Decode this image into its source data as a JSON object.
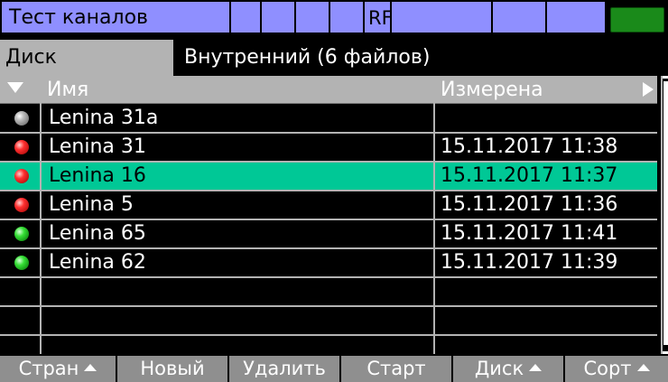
{
  "titlebar": {
    "title": "Тест каналов",
    "rf": "RF",
    "battery": "battery-icon"
  },
  "diskbar": {
    "label": "Диск",
    "value": "Внутренний (6 файлов)"
  },
  "table": {
    "header": {
      "name": "Имя",
      "measured": "Измерена"
    },
    "rows": [
      {
        "name": "Lenina 31a",
        "date": "",
        "status": "gray"
      },
      {
        "name": "Lenina 31",
        "date": "15.11.2017 11:38",
        "status": "red"
      },
      {
        "name": "Lenina 16",
        "date": "15.11.2017 11:37",
        "status": "red",
        "selected": true
      },
      {
        "name": "Lenina 5",
        "date": "15.11.2017 11:36",
        "status": "red"
      },
      {
        "name": "Lenina 65",
        "date": "15.11.2017 11:41",
        "status": "green"
      },
      {
        "name": "Lenina 62",
        "date": "15.11.2017 11:39",
        "status": "green"
      }
    ]
  },
  "softkeys": [
    "Стран",
    "Новый",
    "Удалить",
    "Старт",
    "Диск",
    "Сорт"
  ],
  "colors": {
    "accent": "#00c896",
    "title_bg": "#8f8fff",
    "battery": "#1a8a1a"
  }
}
